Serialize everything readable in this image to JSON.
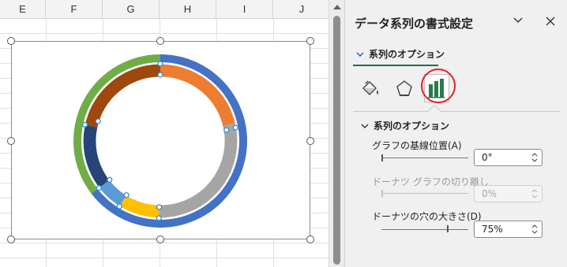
{
  "sheet": {
    "columns": [
      "E",
      "F",
      "G",
      "H",
      "I",
      "J"
    ]
  },
  "pane": {
    "title": "データ系列の書式設定",
    "options_dropdown": "系列のオプション",
    "section_title": "系列のオプション",
    "fields": [
      {
        "label": "グラフの基線位置(A)",
        "value": "0°",
        "enabled": true,
        "level": 0.0
      },
      {
        "label": "ドーナツ グラフの切り離し",
        "value": "0%",
        "enabled": false,
        "level": 0.0
      },
      {
        "label": "ドーナツの穴の大きさ(D)",
        "value": "75%",
        "enabled": true,
        "level": 0.75
      }
    ]
  },
  "colors": {
    "blue": "#4472c4",
    "orange": "#ed7d31",
    "gray": "#a5a5a5",
    "gold": "#ffc000",
    "light_blue": "#5b9bd5",
    "green": "#70ad47",
    "dark_blue": "#264478",
    "brown": "#9e480e",
    "accent_green": "#1f6e43",
    "highlight_red": "#e0202a"
  }
}
